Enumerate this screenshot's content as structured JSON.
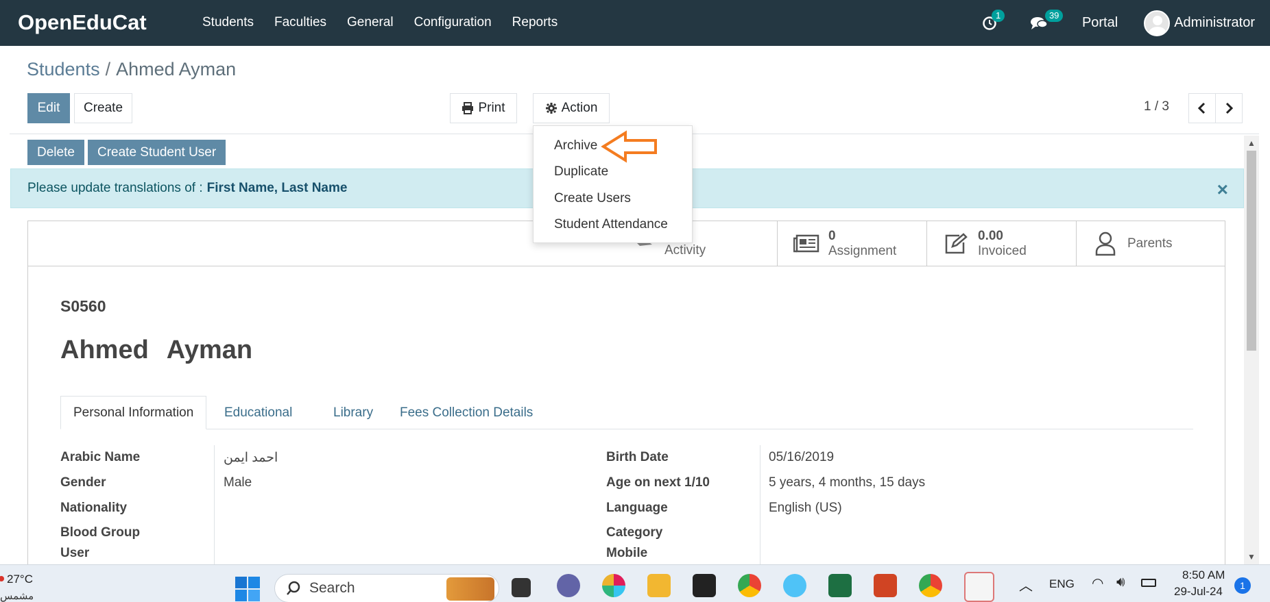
{
  "navbar": {
    "brand": "OpenEduCat",
    "menu": [
      "Students",
      "Faculties",
      "General",
      "Configuration",
      "Reports"
    ],
    "activity_count": "1",
    "messages_count": "39",
    "portal": "Portal",
    "user": "Administrator"
  },
  "breadcrumb": {
    "parent": "Students",
    "separator": "/",
    "current": "Ahmed Ayman"
  },
  "toolbar": {
    "edit": "Edit",
    "create": "Create",
    "print": "Print",
    "action": "Action",
    "pager": "1 / 3"
  },
  "statusbar": {
    "delete": "Delete",
    "create_student_user": "Create Student User"
  },
  "alert": {
    "text": "Please update translations of :",
    "fields": "First Name, Last Name",
    "close": "×"
  },
  "action_menu": [
    "Archive",
    "Duplicate",
    "Create Users",
    "Student Attendance"
  ],
  "smart_buttons": {
    "activity": {
      "label": "Activity"
    },
    "assignment": {
      "count": "0",
      "label": "Assignment"
    },
    "invoiced": {
      "count": "0.00",
      "label": "Invoiced"
    },
    "parents": {
      "label": "Parents"
    }
  },
  "record": {
    "ref": "S0560",
    "first_name": "Ahmed",
    "last_name": "Ayman"
  },
  "tabs": [
    "Personal Information",
    "Educational",
    "Library",
    "Fees Collection Details"
  ],
  "fields_left": [
    {
      "label": "Arabic Name",
      "value": "احمد ايمن"
    },
    {
      "label": "Gender",
      "value": "Male"
    },
    {
      "label": "Nationality",
      "value": ""
    },
    {
      "label": "Blood Group",
      "value": ""
    },
    {
      "label": "User",
      "value": ""
    }
  ],
  "fields_right": [
    {
      "label": "Birth Date",
      "value": "05/16/2019"
    },
    {
      "label": "Age on next 1/10",
      "value": "5 years, 4 months, 15 days"
    },
    {
      "label": "Language",
      "value": "English (US)"
    },
    {
      "label": "Category",
      "value": ""
    },
    {
      "label": "Mobile",
      "value": ""
    }
  ],
  "taskbar": {
    "weather": "27°C",
    "weather_sub": "مشمس",
    "search": "Search",
    "lang": "ENG",
    "time": "8:50 AM",
    "date": "29-Jul-24",
    "notif": "1"
  },
  "colors": {
    "navbar": "#243742",
    "primary": "#5f8aa6",
    "annotation_arrow": "#f47c20"
  }
}
